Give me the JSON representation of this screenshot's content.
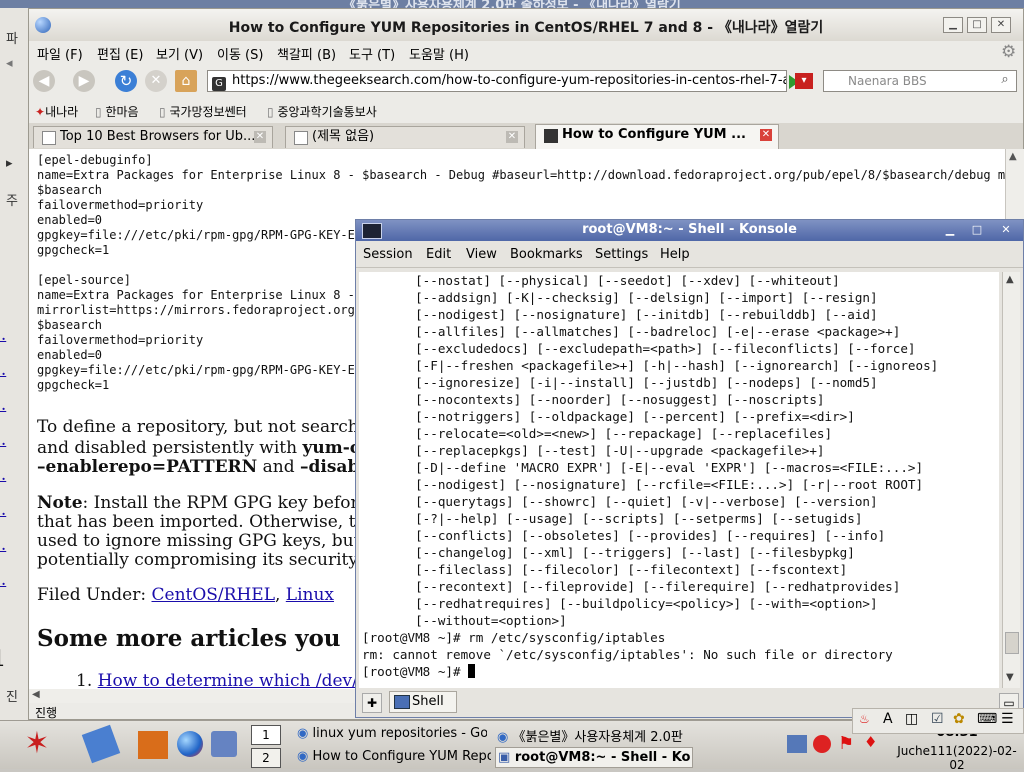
{
  "background_window": {
    "title": "《붉은별》사용자용체계 2.0판 출하정보 - 《내나라》열람기"
  },
  "left_edge_glyphs": [
    "파",
    "주",
    "진"
  ],
  "browser": {
    "title": "How to Configure YUM Repositories in CentOS/RHEL 7 and 8 - 《내나라》열람기",
    "menu": [
      "파일 (F)",
      "편집 (E)",
      "보기 (V)",
      "이동 (S)",
      "책갈피 (B)",
      "도구 (T)",
      "도움말 (H)"
    ],
    "url": "https://www.thegeeksearch.com/how-to-configure-yum-repositories-in-centos-rhel-7-and-8/",
    "search_placeholder": "Naenara BBS",
    "bookmarks": [
      "내나라",
      "한마음",
      "국가망정보쎈터",
      "중앙과학기술통보사"
    ],
    "tabs": [
      {
        "label": "Top 10 Best Browsers for Ub...",
        "active": false
      },
      {
        "label": "(제목 없음)",
        "active": false
      },
      {
        "label": "How to Configure YUM ...",
        "active": true
      }
    ],
    "status": "진행",
    "content": {
      "code_block_1": [
        "[epel-debuginfo]",
        "name=Extra Packages for Enterprise Linux 8 - $basearch - Debug #baseurl=http://download.fedoraproject.org/pub/epel/8/$basearch/debug mirror",
        "$basearch",
        "failovermethod=priority",
        "enabled=0",
        "gpgkey=file:///etc/pki/rpm-gpg/RPM-GPG-KEY-EPE",
        "gpgcheck=1",
        "",
        "[epel-source]",
        "name=Extra Packages for Enterprise Linux 8 - S",
        "mirrorlist=https://mirrors.fedoraproject.org/m",
        "$basearch",
        "failovermethod=priority",
        "enabled=0",
        "gpgkey=file:///etc/pki/rpm-gpg/RPM-GPG-KEY-EPE",
        "gpgcheck=1"
      ],
      "para1_line1": "To define a repository, but not search",
      "para1_line2_a": "and disabled persistently with ",
      "para1_line2_b": "yum-co",
      "para1_line3_a": "–enablerepo=PATTERN",
      "para1_line3_b": " and ",
      "para1_line3_c": "–disabl",
      "note_label": "Note",
      "note_line1": ": Install the RPM GPG key before",
      "note_line2": "that has been imported. Otherwise, the",
      "note_line3": "used to ignore missing GPG keys, but t",
      "note_line4": "potentially compromising its security.",
      "filed_under_label": "Filed Under: ",
      "filed_link1": "CentOS/RHEL",
      "filed_sep": ", ",
      "filed_link2": "Linux",
      "heading": "Some more articles you",
      "list_num": "1.",
      "list_link": "How to determine which /dev/map",
      "left_numbers": [
        "1.",
        "2.",
        "3.",
        "4.",
        "2.",
        "3.",
        "4.",
        "4."
      ],
      "heading_num": "1"
    }
  },
  "konsole": {
    "title": "root@VM8:~ - Shell - Konsole",
    "menu": [
      "Session",
      "Edit",
      "View",
      "Bookmarks",
      "Settings",
      "Help"
    ],
    "lines": [
      "       [--nostat] [--physical] [--seedot] [--xdev] [--whiteout]",
      "       [--addsign] [-K|--checksig] [--delsign] [--import] [--resign]",
      "       [--nodigest] [--nosignature] [--initdb] [--rebuilddb] [--aid]",
      "       [--allfiles] [--allmatches] [--badreloc] [-e|--erase <package>+]",
      "       [--excludedocs] [--excludepath=<path>] [--fileconflicts] [--force]",
      "       [-F|--freshen <packagefile>+] [-h|--hash] [--ignorearch] [--ignoreos]",
      "       [--ignoresize] [-i|--install] [--justdb] [--nodeps] [--nomd5]",
      "       [--nocontexts] [--noorder] [--nosuggest] [--noscripts]",
      "       [--notriggers] [--oldpackage] [--percent] [--prefix=<dir>]",
      "       [--relocate=<old>=<new>] [--repackage] [--replacefiles]",
      "       [--replacepkgs] [--test] [-U|--upgrade <packagefile>+]",
      "       [-D|--define 'MACRO EXPR'] [-E|--eval 'EXPR'] [--macros=<FILE:...>]",
      "       [--nodigest] [--nosignature] [--rcfile=<FILE:...>] [-r|--root ROOT]",
      "       [--querytags] [--showrc] [--quiet] [-v|--verbose] [--version]",
      "       [-?|--help] [--usage] [--scripts] [--setperms] [--setugids]",
      "       [--conflicts] [--obsoletes] [--provides] [--requires] [--info]",
      "       [--changelog] [--xml] [--triggers] [--last] [--filesbypkg]",
      "       [--fileclass] [--filecolor] [--filecontext] [--fscontext]",
      "       [--recontext] [--fileprovide] [--filerequire] [--redhatprovides]",
      "       [--redhatrequires] [--buildpolicy=<policy>] [--with=<option>]",
      "       [--without=<option>]",
      "[root@VM8 ~]# rm /etc/sysconfig/iptables",
      "rm: cannot remove `/etc/sysconfig/iptables': No such file or directory"
    ],
    "prompt": "[root@VM8 ~]# ",
    "session_tab": "Shell"
  },
  "taskbar": {
    "pager": [
      "1",
      "2"
    ],
    "tasks": [
      "linux yum repositories - Go",
      "《붉은별》사용자용체계 2.0판",
      "How to Configure YUM Repo",
      "root@VM8:~ - Shell - Ko"
    ],
    "clock": "08:31",
    "date": "Juche111(2022)-02-02"
  },
  "colors": {
    "konsole_title": "#5a70ad",
    "link": "#1a0dab",
    "tab_close_active": "#d9413a"
  }
}
